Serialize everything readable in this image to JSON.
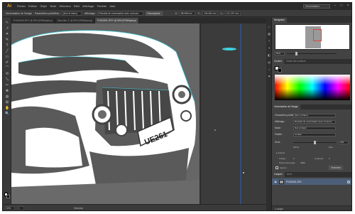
{
  "app": {
    "logo": "Ai",
    "menu": [
      "Fichier",
      "Edition",
      "Objet",
      "Texte",
      "Sélection",
      "Effet",
      "Affichage",
      "Fenêtre",
      "Aide"
    ],
    "workspace": "Vectorisation",
    "window_controls": [
      "–",
      "□",
      "×"
    ]
  },
  "control_bar": {
    "label": "Vectorisation de l'image",
    "preset_label": "Paramètres prédéfinis :",
    "preset_value": "[Noir et blanc]",
    "view_label": "Affichage :",
    "view_value": "Résultat de vectorisation avec contours",
    "button": "Décomposer",
    "x_label": "X :",
    "x_value": "88,088 mm",
    "y_label": "Y :",
    "y_value": "106,481 mm",
    "w_label": "L :",
    "w_value": "211,222 mm"
  },
  "tabs": [
    {
      "label": "P1010005.JPG* @ 50% (RVB/Aperçu)",
      "active": false
    },
    {
      "label": "Sans titre-1* @ 50% (RVB/Aperçu)",
      "active": false
    },
    {
      "label": "P1010001.JPG* @ 50% (RVB/Aperçu)",
      "active": true
    }
  ],
  "tools": [
    "↖",
    "↗",
    "✦",
    "✎",
    "T",
    "╱",
    "▭",
    "✐",
    "⌒",
    "⟲",
    "⤡",
    "✂",
    "✥",
    "◍",
    "⊞",
    "✋",
    "🔍"
  ],
  "status": {
    "zoom": "50%",
    "page": "1",
    "mode": "Sélection"
  },
  "dock_icons": [
    "◐",
    "▦",
    "≡",
    "✶",
    "◧",
    "▤",
    "⌂",
    "⚑"
  ],
  "navigator": {
    "tabs": [
      "Navigation"
    ],
    "zoom_value": "50%"
  },
  "color_panel": {
    "tabs": [
      "Couleur",
      "Guide des couleurs"
    ]
  },
  "trace_panel": {
    "title": "Vectorisation de l'image",
    "preset_label": "Paramètres prédéfinis :",
    "preset_value": "[Noir et blanc]",
    "view_label": "Affichage :",
    "view_value": "Résultat de vectorisation avec contours",
    "mode_label": "Mode :",
    "mode_value": "Noir et blanc",
    "palette_label": "Palette :",
    "palette_value": "Limitée",
    "threshold_label": "Seuil :",
    "threshold_value": "128",
    "less_label": "Moins",
    "more_label": "Plus",
    "advanced_label": "▸ Avancé",
    "paths_label": "Tracés :",
    "paths_value": "0",
    "anchors_label": "Points d'ancrage :",
    "anchors_value": "4286",
    "colors_label": "Couleurs :",
    "colors_value": "2",
    "preview_label": "Aperçu",
    "trace_button": "Vectoriser"
  },
  "layers_panel": {
    "tabs": [
      "Calques",
      "Liens"
    ],
    "layer_name": "P1010001.JPG",
    "footer": "1 calque"
  }
}
